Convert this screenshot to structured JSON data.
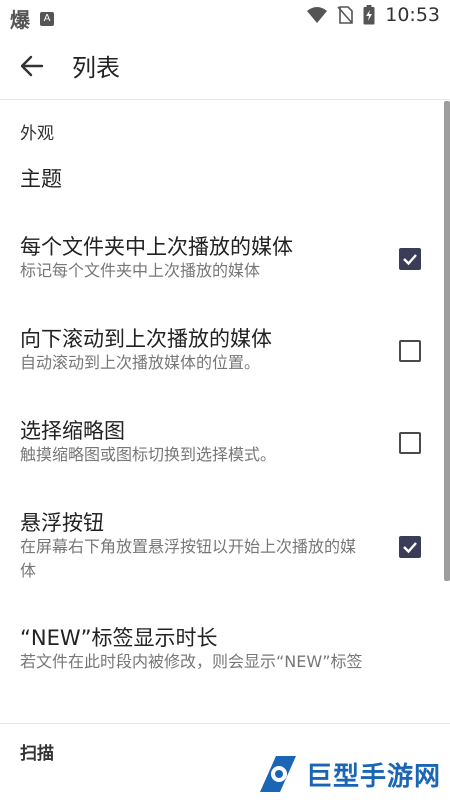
{
  "status_bar": {
    "app_glyph": "爆",
    "badge": "A",
    "time": "10:53"
  },
  "app_bar": {
    "title": "列表"
  },
  "sections": {
    "appearance": {
      "header": "外观",
      "theme_label": "主题"
    },
    "items": [
      {
        "title": "每个文件夹中上次播放的媒体",
        "subtitle": "标记每个文件夹中上次播放的媒体",
        "checked": true
      },
      {
        "title": "向下滚动到上次播放的媒体",
        "subtitle": "自动滚动到上次播放媒体的位置。",
        "checked": false
      },
      {
        "title": "选择缩略图",
        "subtitle": "触摸缩略图或图标切换到选择模式。",
        "checked": false
      },
      {
        "title": "悬浮按钮",
        "subtitle": "在屏幕右下角放置悬浮按钮以开始上次播放的媒体",
        "checked": true
      },
      {
        "title": "“NEW”标签显示时长",
        "subtitle": "若文件在此时段内被修改，则会显示“NEW”标签"
      }
    ],
    "scan": {
      "header": "扫描"
    }
  },
  "watermark": {
    "text": "巨型手游网"
  },
  "colors": {
    "checkbox_checked": "#3b3d58",
    "watermark": "#1a66b5"
  }
}
